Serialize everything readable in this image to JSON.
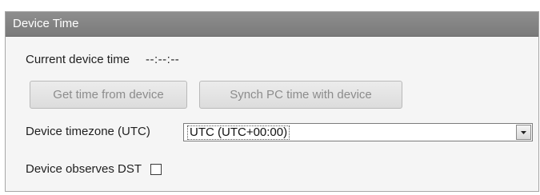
{
  "panel": {
    "title": "Device Time"
  },
  "current_time": {
    "label": "Current device time",
    "value": "--:--:--"
  },
  "buttons": {
    "get_time": "Get time from device",
    "synch_pc": "Synch PC time with device"
  },
  "timezone": {
    "label": "Device timezone (UTC)",
    "selected": "UTC (UTC+00:00)"
  },
  "dst": {
    "label": "Device observes DST",
    "checked": false
  },
  "icons": {
    "dropdown": "chevron-down-icon"
  },
  "colors": {
    "header_bg": "#858585",
    "disabled_text": "#8c8c8c"
  }
}
